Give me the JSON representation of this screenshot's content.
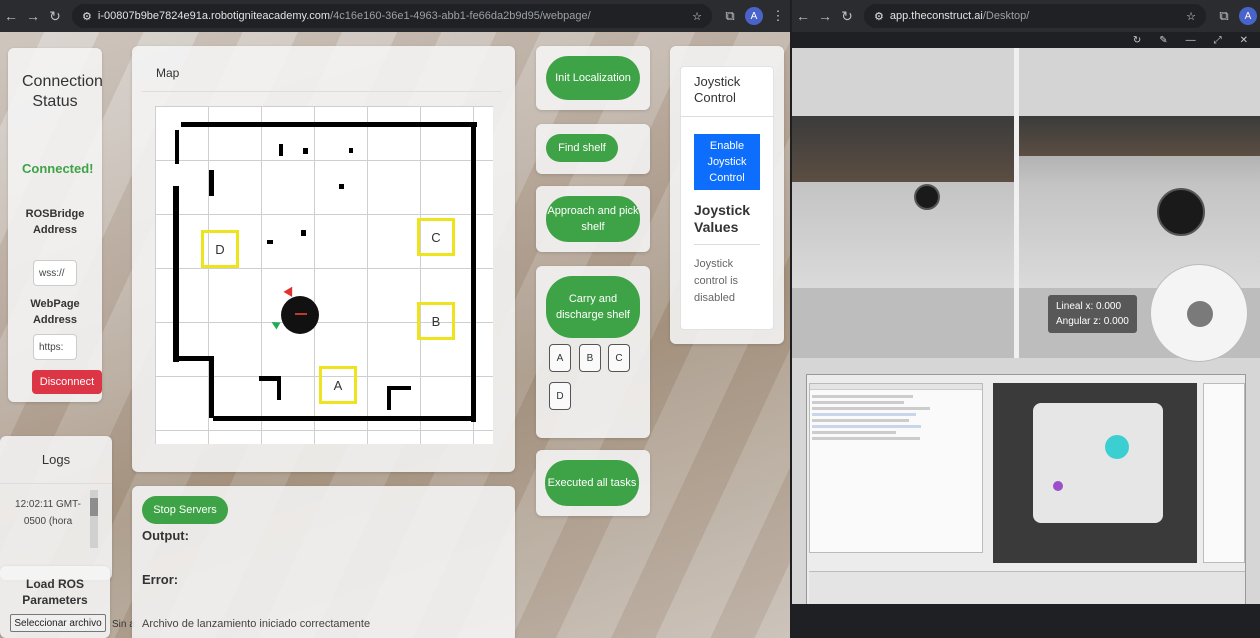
{
  "left_browser": {
    "url_host": "i-00807b9be7824e91a.robotigniteacademy.com",
    "url_path": "/4c16e160-36e1-4963-abb1-fe66da2b9d95/webpage/",
    "avatar": "A"
  },
  "right_browser": {
    "url_host": "app.theconstruct.ai",
    "url_path": "/Desktop/",
    "avatar": "A"
  },
  "connection": {
    "title": "Connection Status",
    "status": "Connected!",
    "rosbridge_label": "ROSBridge Address",
    "rosbridge_value": "wss://",
    "webpage_label": "WebPage Address",
    "webpage_value": "https:",
    "disconnect": "Disconnect"
  },
  "logs": {
    "title": "Logs",
    "entry": "12:02:11 GMT-0500 (hora"
  },
  "load_ros": {
    "title": "Load ROS Parameters",
    "file_button": "Seleccionar archivo",
    "file_status": "Sin a"
  },
  "map": {
    "title": "Map",
    "shelves": [
      "A",
      "B",
      "C",
      "D"
    ],
    "robot_label": "RB"
  },
  "output": {
    "stop_servers": "Stop Servers",
    "output_label": "Output:",
    "error_label": "Error:",
    "message": "Archivo de lanzamiento iniciado correctamente"
  },
  "tasks": {
    "init_localization": "Init Localization",
    "find_shelf": "Find shelf",
    "approach_pick": "Approach and pick shelf",
    "carry_discharge": "Carry and discharge shelf",
    "targets": [
      "A",
      "B",
      "C",
      "D"
    ],
    "executed_all": "Executed all tasks"
  },
  "joystick": {
    "title": "Joystick Control",
    "enable_button": "Enable Joystick Control",
    "values_title": "Joystick Values",
    "disabled_msg": "Joystick control is disabled"
  },
  "camera": {
    "lineal_x": "Lineal x: 0.000",
    "angular_z": "Angular z: 0.000"
  }
}
